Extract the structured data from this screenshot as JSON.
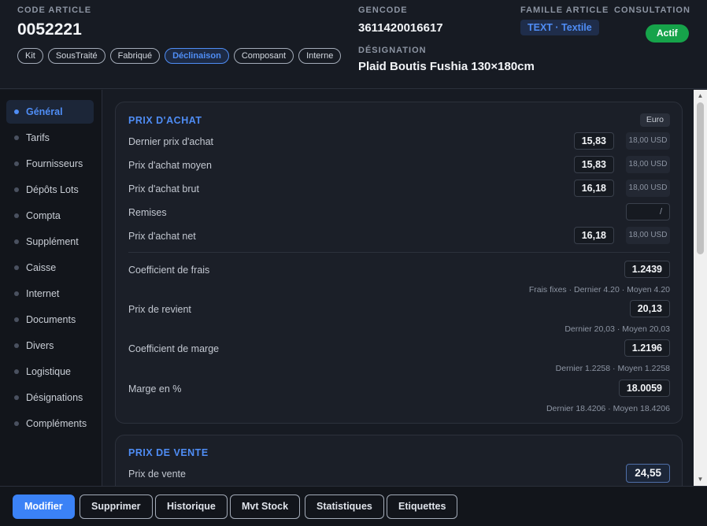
{
  "header": {
    "code_label": "CODE ARTICLE",
    "code_value": "0052221",
    "gencode_label": "GENCODE",
    "gencode_value": "3611420016617",
    "famille_label": "FAMILLE ARTICLE",
    "famille_value": "TEXT · Textile",
    "consultation_label": "CONSULTATION",
    "status": "Actif",
    "designation_label": "DÉSIGNATION",
    "designation_value": "Plaid Boutis Fushia 130×180cm",
    "chips": [
      "Kit",
      "SousTraité",
      "Fabriqué",
      "Déclinaison",
      "Composant",
      "Interne"
    ],
    "active_chip": "Déclinaison"
  },
  "sidebar": {
    "items": [
      "Général",
      "Tarifs",
      "Fournisseurs",
      "Dépôts Lots",
      "Compta",
      "Supplément",
      "Caisse",
      "Internet",
      "Documents",
      "Divers",
      "Logistique",
      "Désignations",
      "Compléments"
    ],
    "active": "Général"
  },
  "achat": {
    "title": "PRIX D'ACHAT",
    "currency": "Euro",
    "dernier_label": "Dernier prix d'achat",
    "dernier_value": "15,83",
    "dernier_usd": "18,00 USD",
    "moyen_label": "Prix d'achat moyen",
    "moyen_value": "15,83",
    "moyen_usd": "18,00 USD",
    "brut_label": "Prix d'achat brut",
    "brut_value": "16,18",
    "brut_usd": "18,00 USD",
    "remises_label": "Remises",
    "remises_value": "/",
    "net_label": "Prix d'achat net",
    "net_value": "16,18",
    "net_usd": "18,00 USD",
    "coef_frais_label": "Coefficient de frais",
    "coef_frais_value": "1.2439",
    "coef_frais_sub": "Frais fixes · Dernier 4.20 · Moyen 4.20",
    "revient_label": "Prix de revient",
    "revient_value": "20,13",
    "revient_sub": "Dernier 20,03 · Moyen 20,03",
    "coef_marge_label": "Coefficient de marge",
    "coef_marge_value": "1.2196",
    "coef_marge_sub": "Dernier 1.2258 · Moyen 1.2258",
    "marge_label": "Marge en %",
    "marge_value": "18.0059",
    "marge_sub": "Dernier 18.4206 · Moyen 18.4206"
  },
  "vente": {
    "title": "PRIX DE VENTE",
    "prix_label": "Prix de vente",
    "prix_value": "24,55"
  },
  "footer": {
    "buttons": [
      "Modifier",
      "Supprimer",
      "Historique",
      "Mvt Stock",
      "Statistiques",
      "Etiquettes"
    ]
  },
  "colors": {
    "accent": "#3b82f6",
    "status_green": "#16a34a",
    "background": "#171b23"
  }
}
